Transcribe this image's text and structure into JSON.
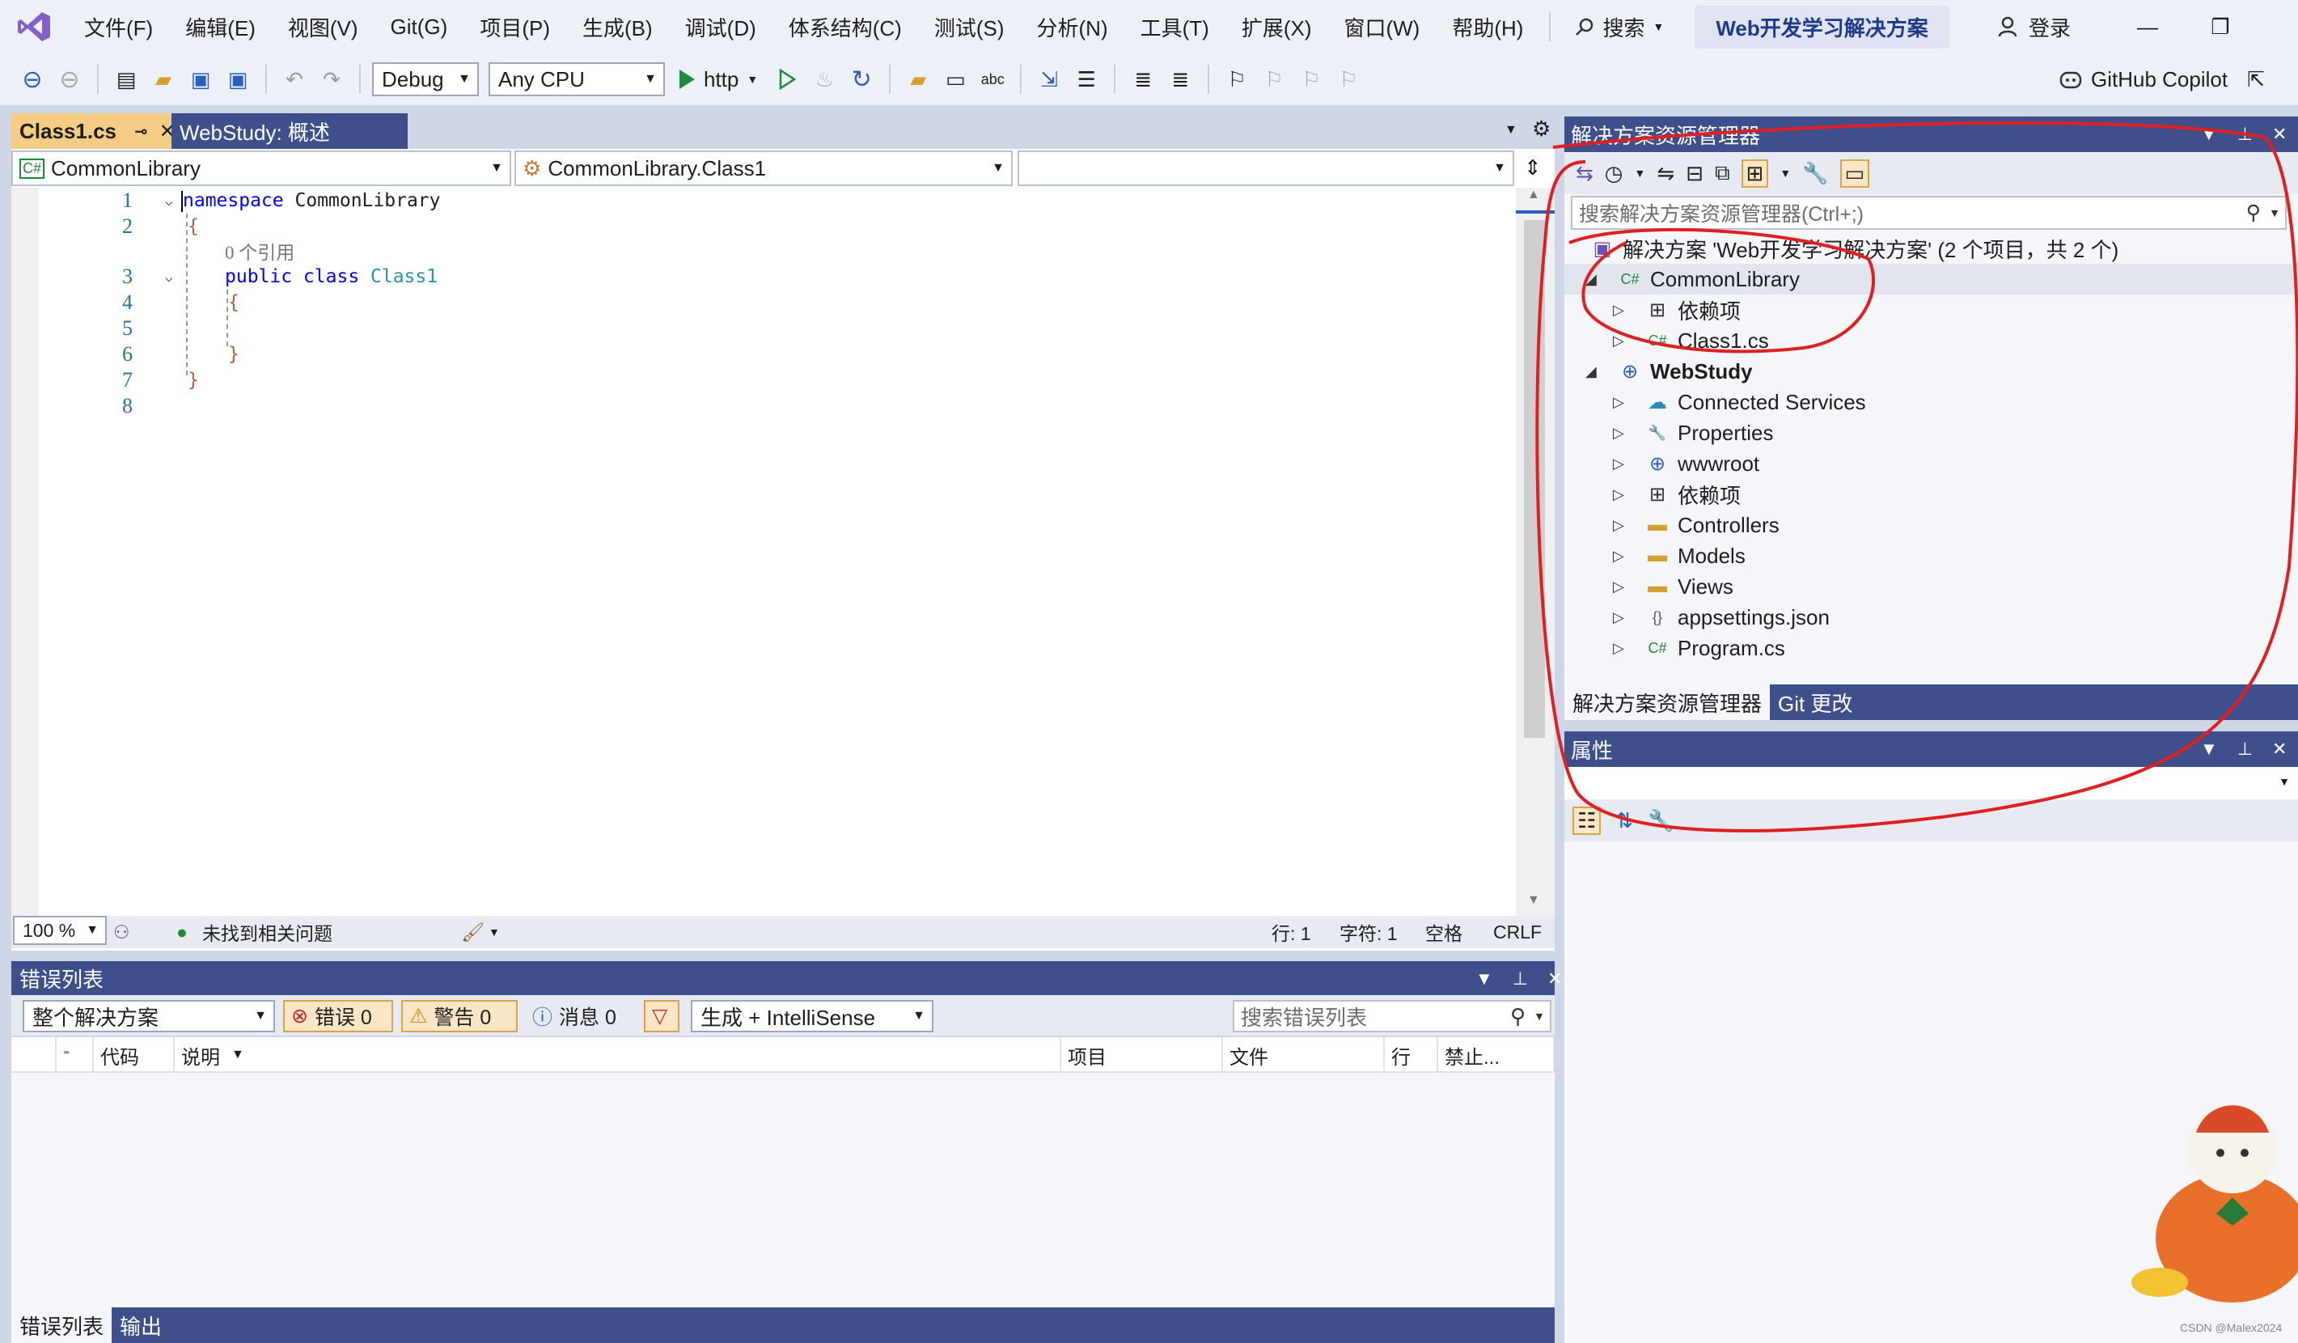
{
  "menu": {
    "items": [
      "文件(F)",
      "编辑(E)",
      "视图(V)",
      "Git(G)",
      "项目(P)",
      "生成(B)",
      "调试(D)",
      "体系结构(C)",
      "测试(S)",
      "分析(N)",
      "工具(T)",
      "扩展(X)",
      "窗口(W)",
      "帮助(H)"
    ],
    "search": "搜索",
    "solution_title": "Web开发学习解决方案",
    "login": "登录"
  },
  "toolbar": {
    "config": "Debug",
    "platform": "Any CPU",
    "run_target": "http",
    "copilot": "GitHub Copilot"
  },
  "editor": {
    "tabs": [
      {
        "label": "Class1.cs",
        "active": true
      },
      {
        "label": "WebStudy: 概述",
        "active": false
      }
    ],
    "nav": {
      "project": "CommonLibrary",
      "type": "CommonLibrary.Class1",
      "member": ""
    },
    "lines": [
      {
        "n": "1",
        "kw": "namespace",
        "rest": " CommonLibrary"
      },
      {
        "n": "2",
        "text": "{"
      },
      {
        "n": "",
        "ref": "0 个引用"
      },
      {
        "n": "3",
        "kw": "public class",
        "typ": " Class1"
      },
      {
        "n": "4",
        "text": "{"
      },
      {
        "n": "5",
        "text": ""
      },
      {
        "n": "6",
        "text": "}"
      },
      {
        "n": "7",
        "text": "}"
      },
      {
        "n": "8",
        "text": ""
      }
    ],
    "status": {
      "zoom": "100 %",
      "issues": "未找到相关问题",
      "line": "行: 1",
      "char": "字符: 1",
      "space": "空格",
      "eol": "CRLF"
    }
  },
  "error_list": {
    "title": "错误列表",
    "scope": "整个解决方案",
    "errors": "错误 0",
    "warnings": "警告 0",
    "messages": "消息 0",
    "source": "生成 + IntelliSense",
    "search_placeholder": "搜索错误列表",
    "columns": [
      "代码",
      "说明",
      "项目",
      "文件",
      "行",
      "禁止..."
    ],
    "bottom_tabs": [
      "错误列表",
      "输出"
    ]
  },
  "solution_explorer": {
    "title": "解决方案资源管理器",
    "search_placeholder": "搜索解决方案资源管理器(Ctrl+;)",
    "tree": [
      {
        "label": "解决方案 'Web开发学习解决方案' (2 个项目，共 2 个)",
        "icon": "solution-icon",
        "depth": 0,
        "expand": "none"
      },
      {
        "label": "CommonLibrary",
        "icon": "csharp-project-icon",
        "depth": 1,
        "expand": "open",
        "selected": true
      },
      {
        "label": "依赖项",
        "icon": "dependencies-icon",
        "depth": 2,
        "expand": "closed"
      },
      {
        "label": "Class1.cs",
        "icon": "csharp-file-icon",
        "depth": 2,
        "expand": "closed"
      },
      {
        "label": "WebStudy",
        "icon": "web-project-icon",
        "depth": 1,
        "expand": "open",
        "bold": true
      },
      {
        "label": "Connected Services",
        "icon": "connected-services-icon",
        "depth": 2,
        "expand": "closed"
      },
      {
        "label": "Properties",
        "icon": "properties-icon",
        "depth": 2,
        "expand": "closed"
      },
      {
        "label": "wwwroot",
        "icon": "globe-icon",
        "depth": 2,
        "expand": "closed"
      },
      {
        "label": "依赖项",
        "icon": "dependencies-icon",
        "depth": 2,
        "expand": "closed"
      },
      {
        "label": "Controllers",
        "icon": "folder-icon",
        "depth": 2,
        "expand": "closed"
      },
      {
        "label": "Models",
        "icon": "folder-icon",
        "depth": 2,
        "expand": "closed"
      },
      {
        "label": "Views",
        "icon": "folder-icon",
        "depth": 2,
        "expand": "closed"
      },
      {
        "label": "appsettings.json",
        "icon": "json-file-icon",
        "depth": 2,
        "expand": "closed"
      },
      {
        "label": "Program.cs",
        "icon": "csharp-file-icon",
        "depth": 2,
        "expand": "closed"
      }
    ],
    "tabs": [
      "解决方案资源管理器",
      "Git 更改"
    ]
  },
  "properties": {
    "title": "属性"
  },
  "watermark": "CSDN @Malex2024",
  "colors": {
    "panel_header": "#3e4f8c",
    "active_tab": "#f5cc84",
    "annotation": "#e02020"
  }
}
